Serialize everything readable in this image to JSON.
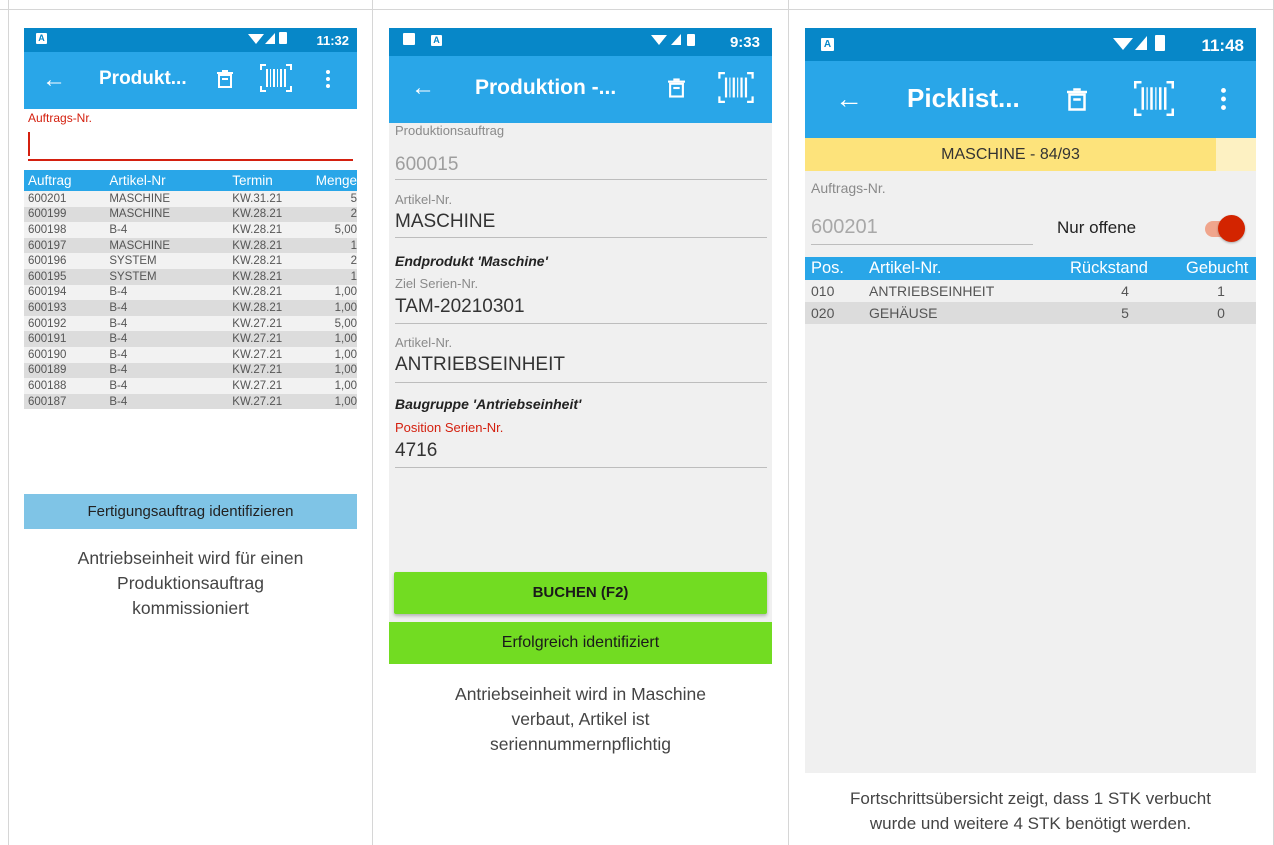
{
  "phone1": {
    "status_time": "11:32",
    "title": "Produkt...",
    "field_label": "Auftrags-Nr.",
    "field_value": "",
    "columns": [
      "Auftrag",
      "Artikel-Nr",
      "Termin",
      "Menge"
    ],
    "rows": [
      [
        "600201",
        "MASCHINE",
        "KW.31.21",
        "5"
      ],
      [
        "600199",
        "MASCHINE",
        "KW.28.21",
        "2"
      ],
      [
        "600198",
        "B-4",
        "KW.28.21",
        "5,00"
      ],
      [
        "600197",
        "MASCHINE",
        "KW.28.21",
        "1"
      ],
      [
        "600196",
        "SYSTEM",
        "KW.28.21",
        "2"
      ],
      [
        "600195",
        "SYSTEM",
        "KW.28.21",
        "1"
      ],
      [
        "600194",
        "B-4",
        "KW.28.21",
        "1,00"
      ],
      [
        "600193",
        "B-4",
        "KW.28.21",
        "1,00"
      ],
      [
        "600192",
        "B-4",
        "KW.27.21",
        "5,00"
      ],
      [
        "600191",
        "B-4",
        "KW.27.21",
        "1,00"
      ],
      [
        "600190",
        "B-4",
        "KW.27.21",
        "1,00"
      ],
      [
        "600189",
        "B-4",
        "KW.27.21",
        "1,00"
      ],
      [
        "600188",
        "B-4",
        "KW.27.21",
        "1,00"
      ],
      [
        "600187",
        "B-4",
        "KW.27.21",
        "1,00"
      ]
    ],
    "banner": "Fertigungsauftrag identifizieren"
  },
  "caption1": [
    "Antriebseinheit wird für einen",
    "Produktionsauftrag",
    "kommissioniert"
  ],
  "phone2": {
    "status_time": "9:33",
    "title": "Produktion -...",
    "prod_label": "Produktionsauftrag",
    "prod_value": "600015",
    "art_label": "Artikel-Nr.",
    "art_value": "MASCHINE",
    "endprodukt_heading": "Endprodukt 'Maschine'",
    "ziel_label": "Ziel Serien-Nr.",
    "ziel_value": "TAM-20210301",
    "art2_label": "Artikel-Nr.",
    "art2_value": "ANTRIEBSEINHEIT",
    "baugruppe_heading": "Baugruppe 'Antriebseinheit'",
    "pos_label": "Position Serien-Nr.",
    "pos_value": "4716",
    "book_button": "BUCHEN (F2)",
    "banner": "Erfolgreich identifiziert"
  },
  "caption2": [
    "Antriebseinheit wird in Maschine",
    "verbaut, Artikel ist",
    "seriennummernpflichtig"
  ],
  "phone3": {
    "status_time": "11:48",
    "title": "Picklist...",
    "banner": "MASCHINE - 84/93",
    "field_label": "Auftrags-Nr.",
    "field_value": "600201",
    "toggle_label": "Nur offene",
    "toggle_on": true,
    "columns": [
      "Pos.",
      "Artikel-Nr.",
      "Rückstand",
      "Gebucht"
    ],
    "rows": [
      [
        "010",
        "ANTRIEBSEINHEIT",
        "4",
        "1"
      ],
      [
        "020",
        "GEHÄUSE",
        "5",
        "0"
      ]
    ]
  },
  "caption3": [
    "Fortschrittsübersicht zeigt, dass 1 STK verbucht",
    "wurde und weitere 4 STK benötigt werden."
  ],
  "icons": {
    "back": "back-arrow-icon",
    "trash": "trash-icon",
    "barcode": "barcode-scan-icon",
    "more": "more-vert-icon"
  },
  "colors": {
    "statusbar": "#0787c8",
    "appbar": "#29a6e8",
    "banner_blue": "#7fc4e6",
    "green": "#72dc22",
    "yellow": "#fde37b",
    "error_red": "#d4200f",
    "toggle_red": "#d32400"
  }
}
